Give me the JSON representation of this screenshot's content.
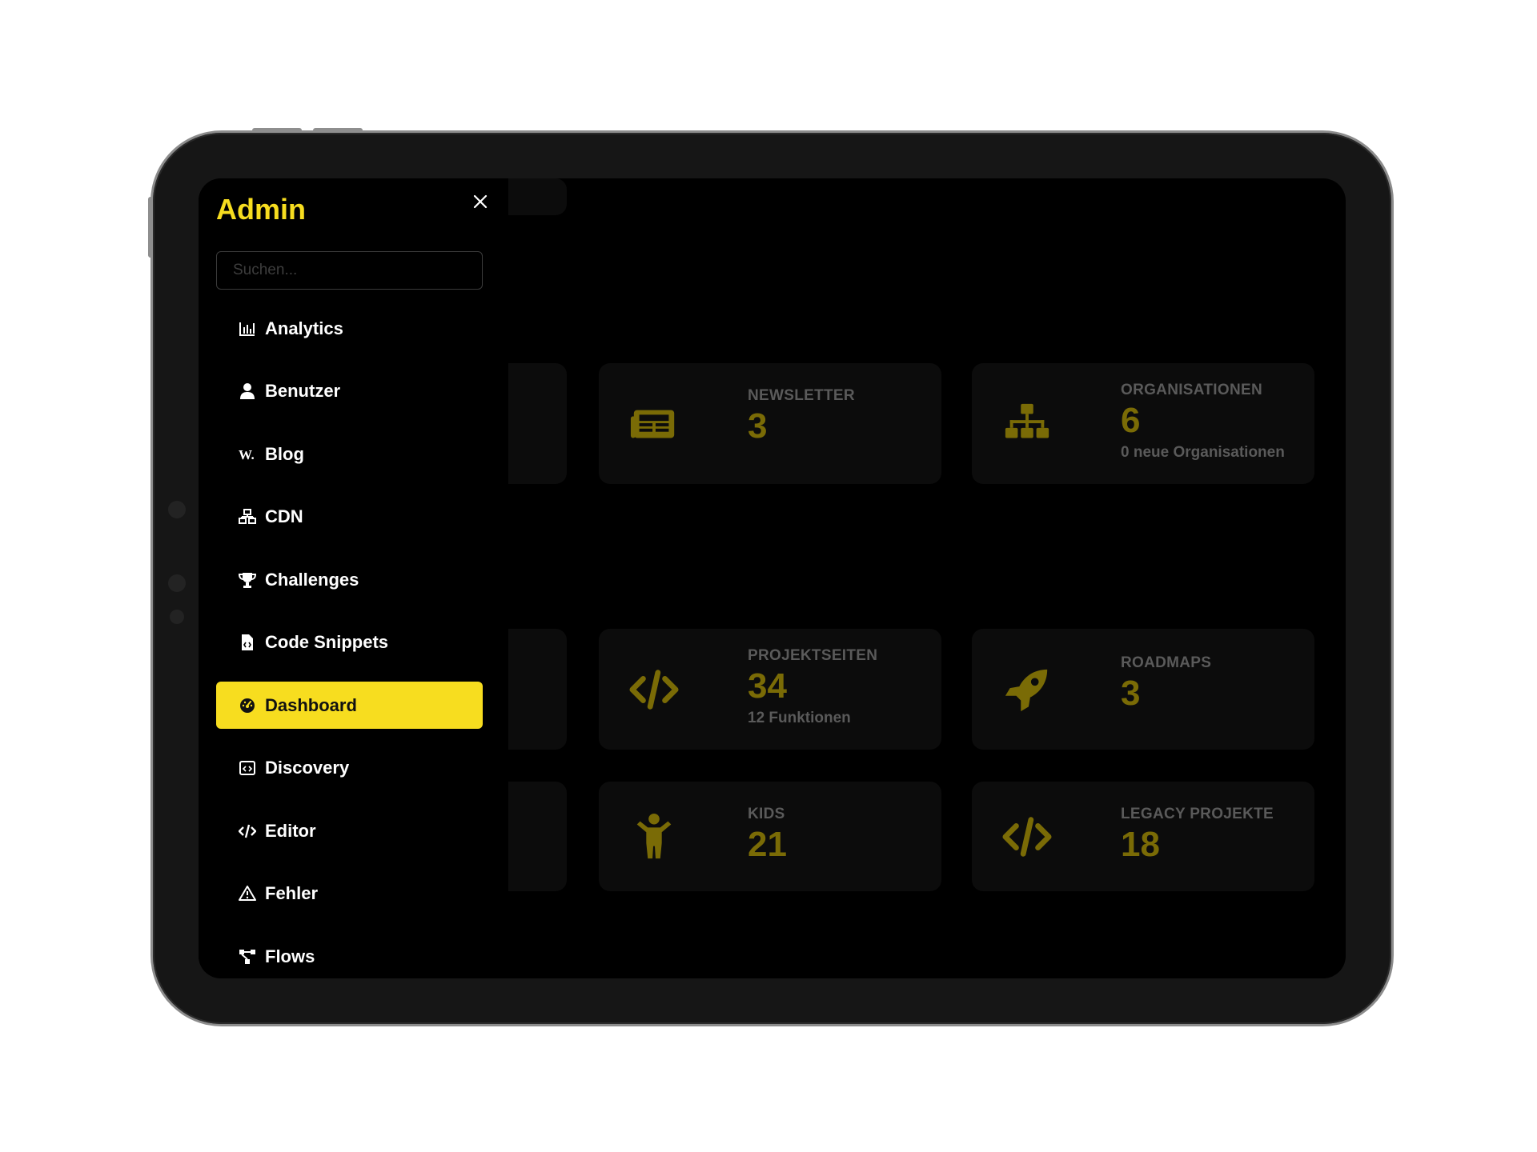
{
  "sidebar": {
    "title": "Admin",
    "search_placeholder": "Suchen...",
    "items": [
      {
        "label": "Analytics",
        "icon": "chart-bar-icon"
      },
      {
        "label": "Benutzer",
        "icon": "user-icon"
      },
      {
        "label": "Blog",
        "icon": "wordpress-icon"
      },
      {
        "label": "CDN",
        "icon": "network-icon"
      },
      {
        "label": "Challenges",
        "icon": "trophy-icon"
      },
      {
        "label": "Code Snippets",
        "icon": "file-code-icon"
      },
      {
        "label": "Dashboard",
        "icon": "gauge-icon",
        "active": true
      },
      {
        "label": "Discovery",
        "icon": "window-code-icon"
      },
      {
        "label": "Editor",
        "icon": "code-icon"
      },
      {
        "label": "Fehler",
        "icon": "warning-icon"
      },
      {
        "label": "Flows",
        "icon": "flow-icon"
      }
    ]
  },
  "cards": {
    "newsletter": {
      "label": "NEWSLETTER",
      "value": "3",
      "icon": "newspaper-icon"
    },
    "organisationen": {
      "label": "ORGANISATIONEN",
      "value": "6",
      "sub": "0 neue Organisationen",
      "icon": "sitemap-icon"
    },
    "projektseiten": {
      "label": "PROJEKTSEITEN",
      "value": "34",
      "sub": "12 Funktionen",
      "icon": "code-icon"
    },
    "roadmaps": {
      "label": "ROADMAPS",
      "value": "3",
      "icon": "rocket-icon"
    },
    "kids": {
      "label": "KIDS",
      "value": "21",
      "icon": "child-icon"
    },
    "legacy": {
      "label": "LEGACY PROJEKTE",
      "value": "18",
      "icon": "code-icon"
    }
  },
  "colors": {
    "accent": "#f7dd1f",
    "accent_dim": "#7a6b06",
    "background": "#000000",
    "card": "#0c0c0c"
  }
}
